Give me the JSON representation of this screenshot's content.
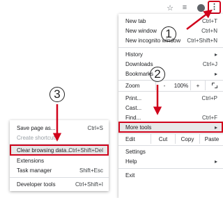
{
  "toolbar": {
    "icons": [
      "star-icon",
      "reading-list-icon",
      "profile-icon",
      "kebab-menu-icon"
    ],
    "kebab_glyph": "⋮"
  },
  "main_menu": {
    "new_tab": {
      "label": "New tab",
      "shortcut": "Ctrl+T"
    },
    "new_window": {
      "label": "New window",
      "shortcut": "Ctrl+N"
    },
    "new_incognito": {
      "label": "New incognito window",
      "shortcut": "Ctrl+Shift+N"
    },
    "history": {
      "label": "History",
      "arrow": "▸"
    },
    "downloads": {
      "label": "Downloads",
      "shortcut": "Ctrl+J"
    },
    "bookmarks": {
      "label": "Bookmarks",
      "arrow": "▸"
    },
    "zoom": {
      "label": "Zoom",
      "minus": "-",
      "value": "100%",
      "plus": "+"
    },
    "print": {
      "label": "Print...",
      "shortcut": "Ctrl+P"
    },
    "cast": {
      "label": "Cast..."
    },
    "find": {
      "label": "Find...",
      "shortcut": "Ctrl+F"
    },
    "more_tools": {
      "label": "More tools",
      "arrow": "▸"
    },
    "edit": {
      "label": "Edit",
      "cut": "Cut",
      "copy": "Copy",
      "paste": "Paste"
    },
    "settings": {
      "label": "Settings"
    },
    "help": {
      "label": "Help",
      "arrow": "▸"
    },
    "exit": {
      "label": "Exit"
    }
  },
  "sub_menu": {
    "save_page": {
      "label": "Save page as...",
      "shortcut": "Ctrl+S"
    },
    "create_shortcut": {
      "label": "Create shortcut..."
    },
    "clear_browsing": {
      "label": "Clear browsing data...",
      "shortcut": "Ctrl+Shift+Del"
    },
    "extensions": {
      "label": "Extensions"
    },
    "task_manager": {
      "label": "Task manager",
      "shortcut": "Shift+Esc"
    },
    "developer_tools": {
      "label": "Developer tools",
      "shortcut": "Ctrl+Shift+I"
    }
  },
  "annotations": {
    "step1": "1",
    "step2": "2",
    "step3": "3",
    "color": "#d0021b"
  }
}
